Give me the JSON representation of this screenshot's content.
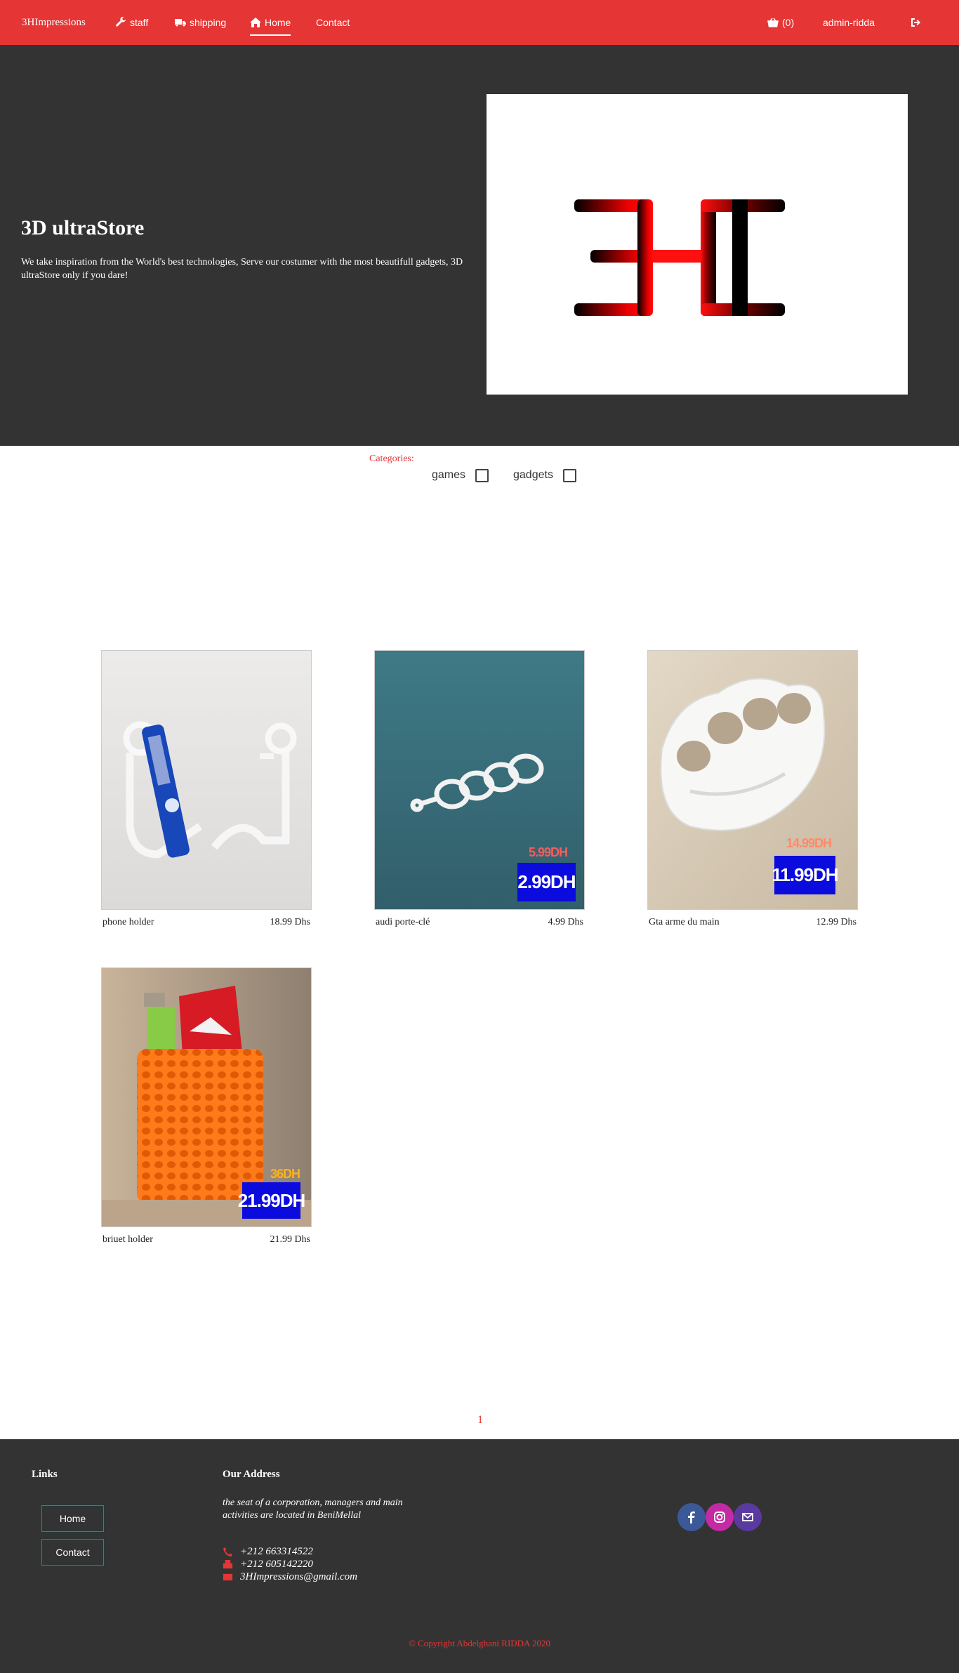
{
  "nav": {
    "brand": "3HImpressions",
    "staff": "staff",
    "shipping": "shipping",
    "home": "Home",
    "contact": "Contact",
    "cart": "(0)",
    "user": "admin-ridda"
  },
  "hero": {
    "title": "3D ultraStore",
    "text": "We take inspiration from the World's best technologies, Serve our costumer with the most beautifull gadgets, 3D ultraStore only if you dare!"
  },
  "categories": {
    "label": "Categories:",
    "options": [
      "games",
      "gadgets"
    ]
  },
  "products": [
    {
      "name": "phone holder",
      "price": "18.99 Dhs"
    },
    {
      "name": "audi porte-clé",
      "price": "4.99 Dhs",
      "tag": "2.99DH",
      "old": "5.99DH"
    },
    {
      "name": "Gta arme du main",
      "price": "12.99 Dhs",
      "tag": "11.99DH",
      "old": "14.99DH"
    },
    {
      "name": "briuet holder",
      "price": "21.99 Dhs",
      "tag": "21.99DH",
      "old": "36DH"
    }
  ],
  "pagination": "1",
  "footer": {
    "links_title": "Links",
    "links": [
      "Home",
      "Contact"
    ],
    "address_title": "Our Address",
    "address_desc": "the seat of a corporation, managers and main activities are located in BeniMellal",
    "phone": "+212 663314522",
    "fax": "+212 605142220",
    "email": "3HImpressions@gmail.com",
    "copyright": "© Copyright Abdelghani RIDDA 2020"
  },
  "colors": {
    "brand": "#e53535",
    "dark": "#333333"
  }
}
